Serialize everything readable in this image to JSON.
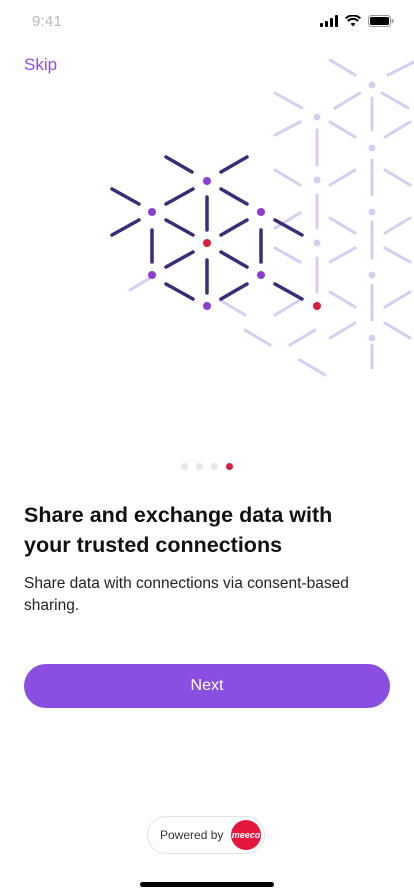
{
  "status": {
    "time": "9:41"
  },
  "skip_label": "Skip",
  "pager": {
    "total": 4,
    "active": 4
  },
  "headline": "Share and exchange data with your trusted connections",
  "body": "Share data with connections via consent-based sharing.",
  "next_label": "Next",
  "footer": {
    "powered_by": "Powered by",
    "brand": "meeco"
  },
  "colors": {
    "accent": "#8a4fe0",
    "dark_line": "#3d2a78",
    "node": "#8a3fd1",
    "highlight": "#d81f3f",
    "faint_line": "#d9ccf3"
  }
}
